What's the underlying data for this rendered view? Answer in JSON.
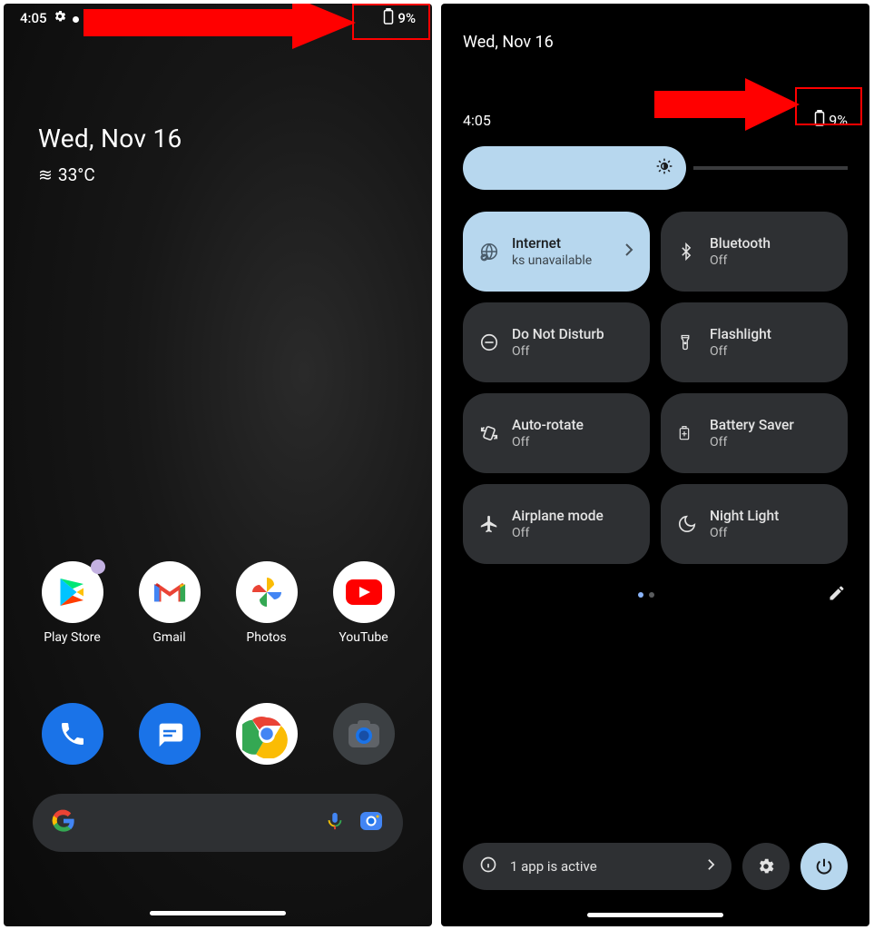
{
  "left": {
    "status": {
      "time": "4:05",
      "battery": "9%"
    },
    "widget": {
      "date": "Wed, Nov 16",
      "temp": "33°C"
    },
    "apps": [
      {
        "name": "playstore",
        "label": "Play Store"
      },
      {
        "name": "gmail",
        "label": "Gmail"
      },
      {
        "name": "photos",
        "label": "Photos"
      },
      {
        "name": "youtube",
        "label": "YouTube"
      }
    ],
    "dock": [
      {
        "name": "phone"
      },
      {
        "name": "messages"
      },
      {
        "name": "chrome"
      },
      {
        "name": "camera"
      }
    ]
  },
  "right": {
    "date": "Wed, Nov 16",
    "status": {
      "time": "4:05",
      "battery": "9%"
    },
    "tiles": [
      {
        "name": "internet",
        "title": "Internet",
        "sub": "ks unavailable",
        "active": true,
        "chevron": true
      },
      {
        "name": "bluetooth",
        "title": "Bluetooth",
        "sub": "Off"
      },
      {
        "name": "dnd",
        "title": "Do Not Disturb",
        "sub": "Off"
      },
      {
        "name": "flashlight",
        "title": "Flashlight",
        "sub": "Off"
      },
      {
        "name": "autorotate",
        "title": "Auto-rotate",
        "sub": "Off"
      },
      {
        "name": "batterysaver",
        "title": "Battery Saver",
        "sub": "Off"
      },
      {
        "name": "airplane",
        "title": "Airplane mode",
        "sub": "Off"
      },
      {
        "name": "nightlight",
        "title": "Night Light",
        "sub": "Off"
      }
    ],
    "footer": {
      "chip": "1 app is active"
    }
  }
}
